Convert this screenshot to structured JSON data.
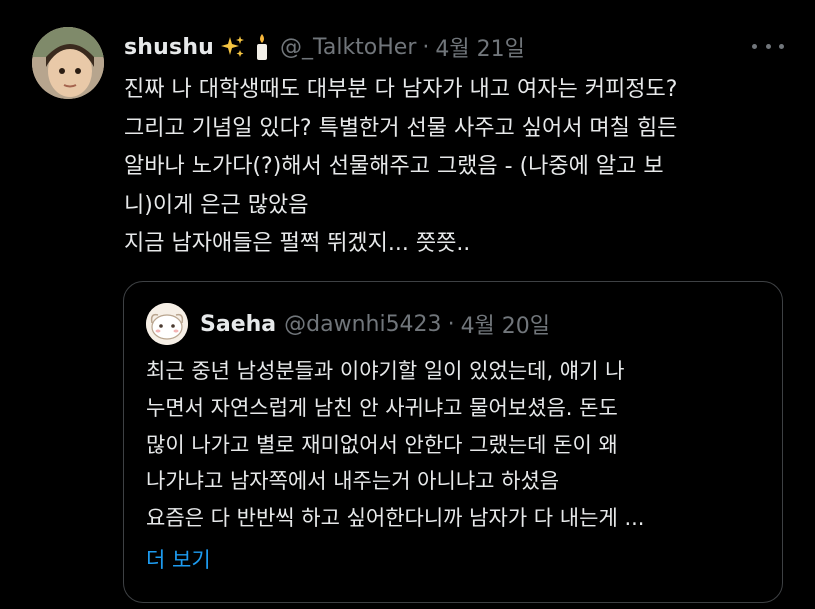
{
  "tweet": {
    "author_name": "shushu",
    "author_emojis": [
      "sparkles-icon",
      "candle-icon"
    ],
    "handle": "@_TalktoHer",
    "separator": "·",
    "date": "4월 21일",
    "lines": [
      "진짜 나 대학생때도 대부분 다 남자가 내고 여자는 커피정도?",
      "그리고 기념일 있다? 특별한거 선물 사주고 싶어서 며칠 힘든",
      "알바나 노가다(?)해서  선물해주고 그랬음 - (나중에 알고 보",
      "니)이게  은근 많았음",
      "지금 남자애들은 펄쩍 뛰겠지... 쯧쯧.."
    ]
  },
  "quoted": {
    "author_name": "Saeha",
    "handle": "@dawnhi5423",
    "separator": "·",
    "date": "4월 20일",
    "lines": [
      "최근 중년 남성분들과 이야기할 일이 있었는데, 얘기 나",
      "누면서 자연스럽게 남친 안 사귀냐고 물어보셨음. 돈도",
      "많이 나가고 별로 재미없어서 안한다 그랬는데 돈이 왜",
      "나가냐고 남자쪽에서 내주는거 아니냐고 하셨음",
      "요즘은 다 반반씩 하고 싶어한다니까 남자가 다 내는게 ..."
    ],
    "show_more": "더 보기"
  },
  "colors": {
    "background": "#000000",
    "text": "#e7e9ea",
    "muted": "#71767b",
    "link": "#1d9bf0",
    "border": "#3e4144"
  }
}
